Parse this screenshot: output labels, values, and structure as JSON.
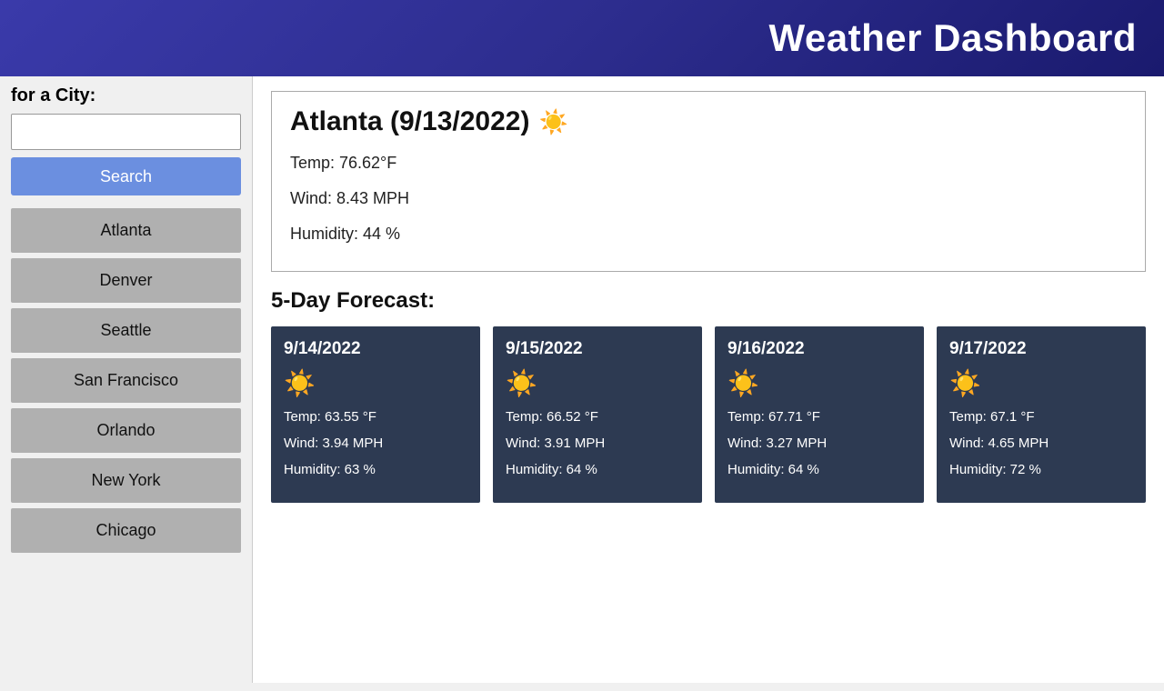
{
  "header": {
    "title": "Weather Dashboard",
    "bg_color": "#2d2d8e"
  },
  "sidebar": {
    "search_label": "for a City:",
    "search_placeholder": "",
    "search_button_label": "Search",
    "cities": [
      {
        "name": "Atlanta"
      },
      {
        "name": "Denver"
      },
      {
        "name": "Seattle"
      },
      {
        "name": "San Francisco"
      },
      {
        "name": "Orlando"
      },
      {
        "name": "New York"
      },
      {
        "name": "Chicago"
      }
    ]
  },
  "current_weather": {
    "city_date": "Atlanta (9/13/2022)",
    "icon": "☀️",
    "temp": "Temp: 76.62°F",
    "wind": "Wind: 8.43 MPH",
    "humidity": "Humidity: 44 %"
  },
  "forecast": {
    "label": "5-Day Forecast:",
    "days": [
      {
        "date": "9/14/2022",
        "icon": "☀️",
        "temp": "Temp: 63.55 °F",
        "wind": "Wind: 3.94 MPH",
        "humidity": "Humidity: 63 %"
      },
      {
        "date": "9/15/2022",
        "icon": "☀️",
        "temp": "Temp: 66.52 °F",
        "wind": "Wind: 3.91 MPH",
        "humidity": "Humidity: 64 %"
      },
      {
        "date": "9/16/2022",
        "icon": "☀️",
        "temp": "Temp: 67.71 °F",
        "wind": "Wind: 3.27 MPH",
        "humidity": "Humidity: 64 %"
      },
      {
        "date": "9/17/2022",
        "icon": "☀️",
        "temp": "Temp: 67.1 °F",
        "wind": "Wind: 4.65 MPH",
        "humidity": "Humidity: 72 %"
      }
    ]
  }
}
